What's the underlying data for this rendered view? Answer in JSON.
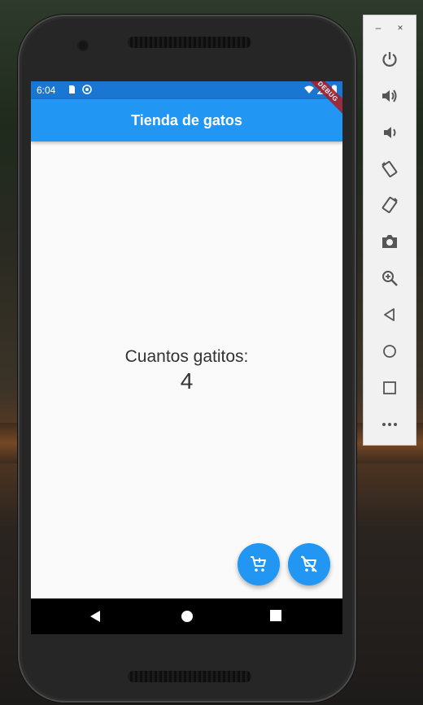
{
  "status": {
    "time": "6:04"
  },
  "app": {
    "title": "Tienda de gatos",
    "debug_banner": "DEBUG"
  },
  "content": {
    "label": "Cuantos gatitos:",
    "count": "4"
  },
  "fabs": [
    {
      "icon": "add-shopping-cart-icon"
    },
    {
      "icon": "remove-shopping-cart-icon"
    }
  ],
  "toolbar": {
    "minimize": "–",
    "close": "×",
    "buttons": [
      "power-icon",
      "volume-up-icon",
      "volume-down-icon",
      "rotate-left-icon",
      "rotate-right-icon",
      "camera-icon",
      "zoom-icon",
      "back-icon",
      "home-icon",
      "overview-icon",
      "more-icon"
    ]
  },
  "colors": {
    "primary": "#2196f3",
    "status_bar": "#1976d2",
    "debug": "#a3212a"
  }
}
